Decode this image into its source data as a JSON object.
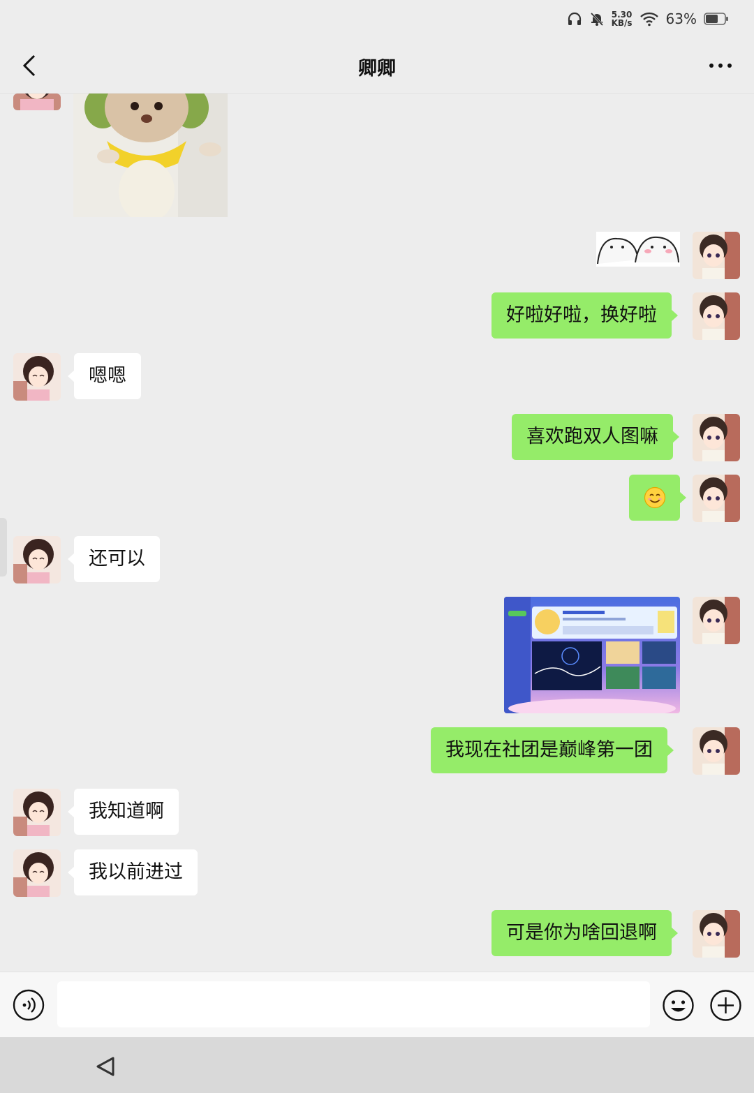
{
  "status_bar": {
    "net_speed_value": "5.30",
    "net_speed_unit": "KB/s",
    "battery_percent": "63%"
  },
  "header": {
    "title": "卿卿"
  },
  "messages": {
    "m1": {
      "sender": "contact",
      "type": "image",
      "content": "plush toy photo"
    },
    "m2": {
      "sender": "me",
      "type": "sticker",
      "content": "two blob sticker"
    },
    "m3": {
      "sender": "me",
      "type": "text",
      "text": "好啦好啦，换好啦"
    },
    "m4": {
      "sender": "contact",
      "type": "text",
      "text": "嗯嗯"
    },
    "m5": {
      "sender": "me",
      "type": "text",
      "text": "喜欢跑双人图嘛"
    },
    "m6": {
      "sender": "me",
      "type": "emoji",
      "text": "😊"
    },
    "m7": {
      "sender": "contact",
      "type": "text",
      "text": "还可以"
    },
    "m8": {
      "sender": "me",
      "type": "image",
      "content": "game club screenshot"
    },
    "m9": {
      "sender": "me",
      "type": "text",
      "text": "我现在社团是巅峰第一团"
    },
    "m10": {
      "sender": "contact",
      "type": "text",
      "text": "我知道啊"
    },
    "m11": {
      "sender": "contact",
      "type": "text",
      "text": "我以前进过"
    },
    "m12": {
      "sender": "me",
      "type": "text",
      "text": "可是你为啥回退啊"
    }
  },
  "input_bar": {
    "value": "",
    "placeholder": ""
  },
  "icons": {
    "back": "chevron-left-icon",
    "more": "more-dots-icon",
    "voice": "voice-icon",
    "emoji": "emoji-icon",
    "plus": "plus-icon",
    "nav_back": "nav-back-triangle-icon"
  },
  "colors": {
    "outgoing_bubble": "#95ec69",
    "incoming_bubble": "#ffffff",
    "background": "#ededed"
  }
}
